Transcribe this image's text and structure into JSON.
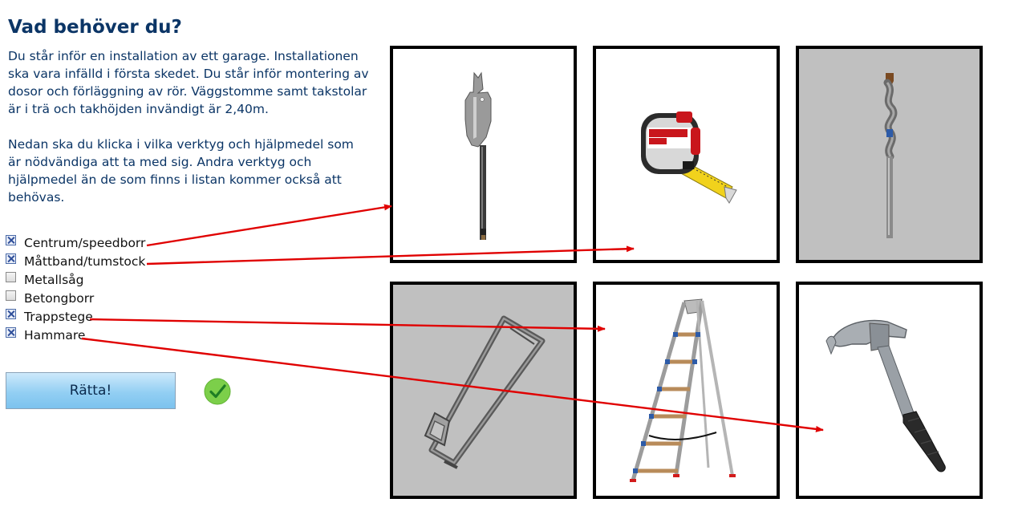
{
  "quiz": {
    "title": "Vad behöver du?",
    "intro_paragraph_1": "Du står inför en installation av ett garage. Installationen ska vara infälld i första skedet. Du står inför montering av dosor och förläggning av rör. Väggstomme samt takstolar är i trä och takhöjden invändigt är 2,40m.",
    "intro_paragraph_2": "Nedan ska du klicka i vilka verktyg och hjälpmedel som är nödvändiga att ta med sig. Andra verktyg och hjälpmedel än de som finns i listan kommer också att behövas.",
    "options": [
      {
        "label": "Centrum/speedborr",
        "checked": true
      },
      {
        "label": "Måttband/tumstock",
        "checked": true
      },
      {
        "label": "Metallsåg",
        "checked": false
      },
      {
        "label": "Betongborr",
        "checked": false
      },
      {
        "label": "Trappstege",
        "checked": true
      },
      {
        "label": "Hammare",
        "checked": true
      }
    ],
    "check_button_label": "Rätta!",
    "result_icon": "checkmark-circle-icon",
    "accent_color": "#0b3566",
    "arrow_color": "#e00000"
  },
  "images": [
    {
      "name": "spade-drill-bit-image",
      "background": "white"
    },
    {
      "name": "tape-measure-image",
      "background": "white"
    },
    {
      "name": "masonry-drill-bit-image",
      "background": "grey"
    },
    {
      "name": "hacksaw-image",
      "background": "grey"
    },
    {
      "name": "step-ladder-image",
      "background": "white"
    },
    {
      "name": "hammer-image",
      "background": "white"
    }
  ]
}
